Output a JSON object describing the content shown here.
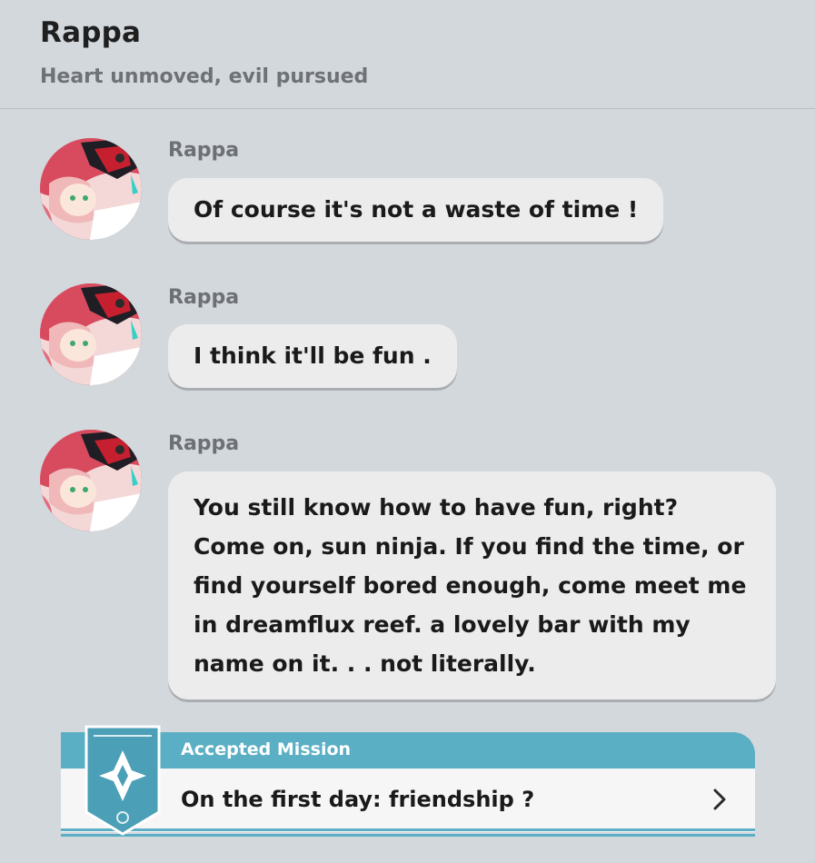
{
  "header": {
    "title": "Rappa",
    "subtitle": "Heart unmoved, evil pursued"
  },
  "messages": [
    {
      "sender": "Rappa",
      "lines": [
        "Of course it's not a waste of time !"
      ]
    },
    {
      "sender": "Rappa",
      "lines": [
        "I think it'll be fun ."
      ]
    },
    {
      "sender": "Rappa",
      "lines": [
        "You still know how to have fun, right?",
        "Come on, sun ninja. If you find the time, or",
        "find yourself bored enough, come meet me",
        "in dreamflux reef. a lovely bar with my",
        "name on it. . . not literally."
      ]
    }
  ],
  "mission": {
    "label": "Accepted Mission",
    "title": "On the first day: friendship ?"
  },
  "icons": {
    "avatar": "character-avatar-icon",
    "emblem": "mission-diamond-icon",
    "chevron": "chevron-right-icon"
  },
  "colors": {
    "background": "#d3d8dd",
    "bubble": "#ececec",
    "accent": "#5bafc4"
  }
}
